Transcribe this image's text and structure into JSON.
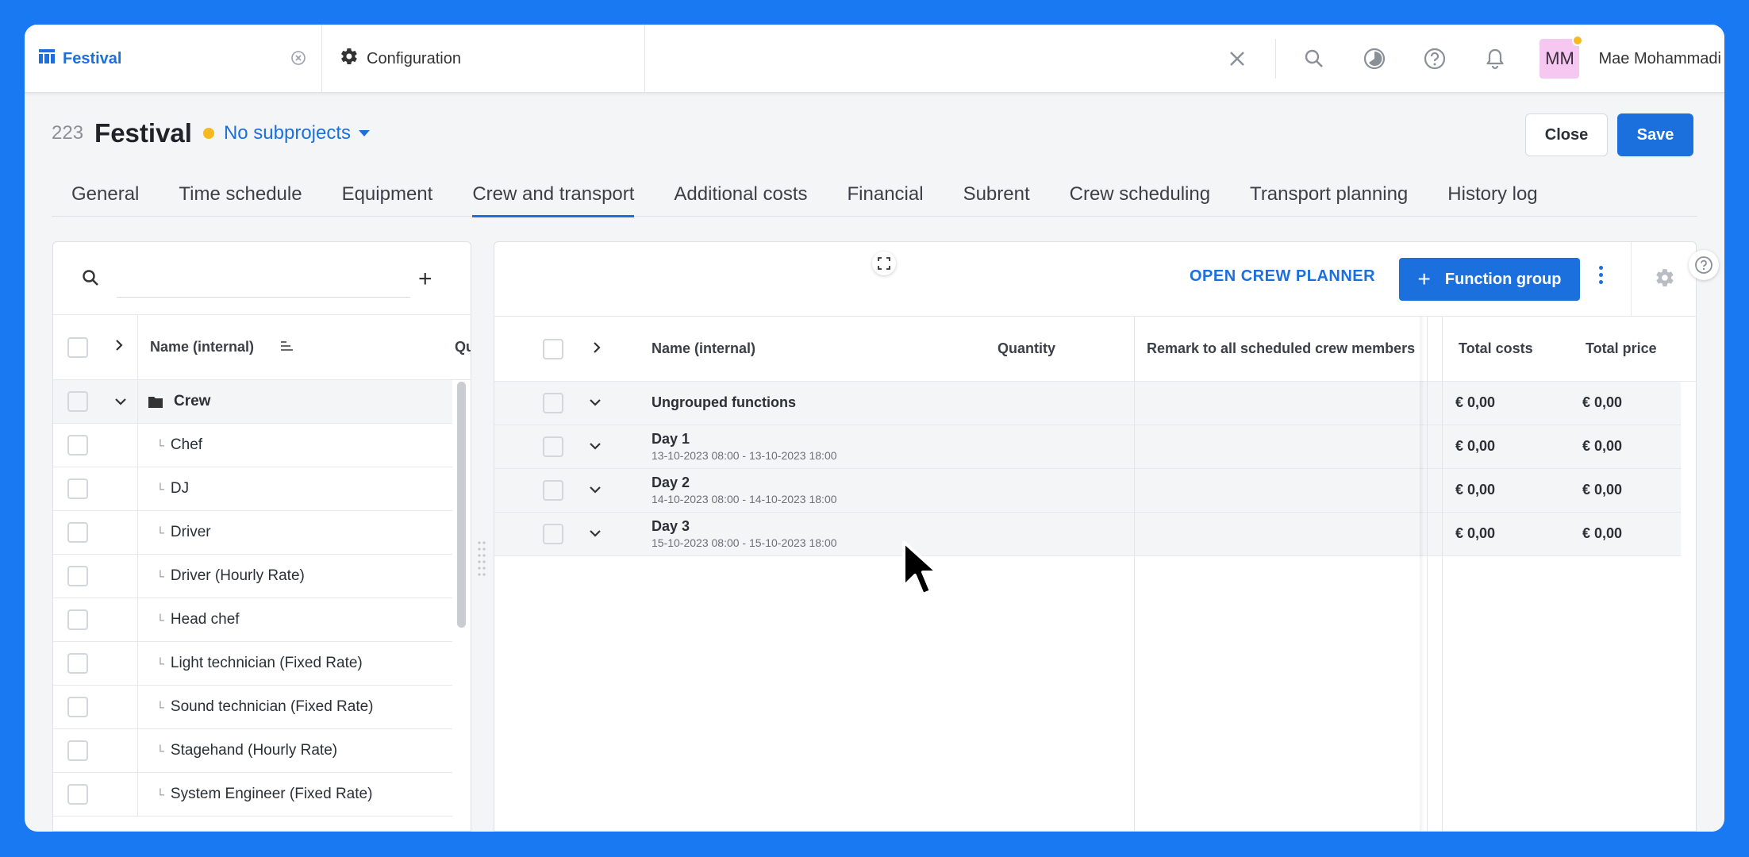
{
  "app_tabs": {
    "festival": "Festival",
    "configuration": "Configuration"
  },
  "user": {
    "initials": "MM",
    "name": "Mae Mohammadi"
  },
  "project": {
    "number": "223",
    "title": "Festival",
    "subprojects": "No subprojects"
  },
  "actions": {
    "close": "Close",
    "save": "Save"
  },
  "tabs": [
    "General",
    "Time schedule",
    "Equipment",
    "Crew and transport",
    "Additional costs",
    "Financial",
    "Subrent",
    "Crew scheduling",
    "Transport planning",
    "History log"
  ],
  "left": {
    "column_name": "Name (internal)",
    "column_qty_cut": "Qu",
    "group": "Crew",
    "items": [
      "Chef",
      "DJ",
      "Driver",
      "Driver (Hourly Rate)",
      "Head chef",
      "Light technician (Fixed Rate)",
      "Sound technician (Fixed Rate)",
      "Stagehand (Hourly Rate)",
      "System Engineer (Fixed Rate)"
    ]
  },
  "right": {
    "open_crew_planner": "OPEN CREW PLANNER",
    "function_group": "Function group",
    "columns": {
      "name": "Name (internal)",
      "quantity": "Quantity",
      "remark": "Remark to all scheduled crew members",
      "total_costs": "Total costs",
      "total_price": "Total price"
    },
    "rows": [
      {
        "title": "Ungrouped functions",
        "sub": "",
        "costs": "€ 0,00",
        "price": "€ 0,00"
      },
      {
        "title": "Day 1",
        "sub": "13-10-2023 08:00 - 13-10-2023 18:00",
        "costs": "€ 0,00",
        "price": "€ 0,00"
      },
      {
        "title": "Day 2",
        "sub": "14-10-2023 08:00 - 14-10-2023 18:00",
        "costs": "€ 0,00",
        "price": "€ 0,00"
      },
      {
        "title": "Day 3",
        "sub": "15-10-2023 08:00 - 15-10-2023 18:00",
        "costs": "€ 0,00",
        "price": "€ 0,00"
      }
    ]
  },
  "colors": {
    "accent": "#1c70dd",
    "background": "#1879f2",
    "status_dot": "#f5b921",
    "avatar_bg": "#f6c8f1"
  }
}
